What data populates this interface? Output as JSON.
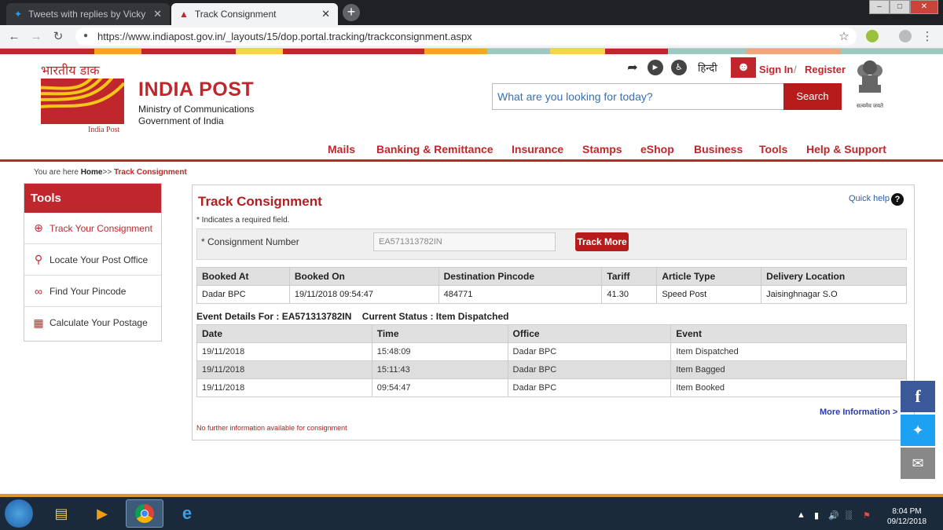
{
  "browser": {
    "tabs": [
      {
        "title": "Tweets with replies by Vicky Shri"
      },
      {
        "title": "Track Consignment"
      }
    ],
    "url": "https://www.indiapost.gov.in/_layouts/15/dop.portal.tracking/trackconsignment.aspx"
  },
  "header": {
    "logo_hindi": "भारतीय डाक",
    "logo_caption": "India Post",
    "brand": "INDIA POST",
    "ministry_line1": "Ministry of Communications",
    "ministry_line2": "Government of India",
    "hindi_link": "हिन्दी",
    "sign_in": "Sign In",
    "register": "Register",
    "search_placeholder": "What are you looking for today?",
    "search_button": "Search",
    "emblem_caption": "सत्यमेव जयते"
  },
  "nav": [
    "Mails",
    "Banking & Remittance",
    "Insurance",
    "Stamps",
    "eShop",
    "Business",
    "Tools",
    "Help & Support"
  ],
  "breadcrumb": {
    "prefix": "You are here",
    "home": "Home",
    "sep": ">>",
    "current": "Track Consignment"
  },
  "sidebar": {
    "title": "Tools",
    "items": [
      "Track Your Consignment",
      "Locate Your Post Office",
      "Find Your Pincode",
      "Calculate Your Postage"
    ]
  },
  "main": {
    "title": "Track Consignment",
    "required_note": "* Indicates a required field.",
    "quick_help": "Quick help",
    "consignment_label": "* Consignment Number",
    "consignment_value": "EA571313782IN",
    "track_more": "Track More",
    "booking_headers": [
      "Booked At",
      "Booked On",
      "Destination Pincode",
      "Tariff",
      "Article Type",
      "Delivery Location"
    ],
    "booking_row": [
      "Dadar BPC",
      "19/11/2018 09:54:47",
      "484771",
      "41.30",
      "Speed Post",
      "Jaisinghnagar S.O"
    ],
    "event_details_label": "Event Details For : EA571313782IN",
    "current_status_label": "Current Status : Item Dispatched",
    "event_headers": [
      "Date",
      "Time",
      "Office",
      "Event"
    ],
    "events": [
      [
        "19/11/2018",
        "15:48:09",
        "Dadar BPC",
        "Item Dispatched"
      ],
      [
        "19/11/2018",
        "15:11:43",
        "Dadar BPC",
        "Item Bagged"
      ],
      [
        "19/11/2018",
        "09:54:47",
        "Dadar BPC",
        "Item Booked"
      ]
    ],
    "more_info": "More Information >",
    "no_info": "No further information available for consignment"
  },
  "taskbar": {
    "time": "8:04 PM",
    "date": "09/12/2018"
  },
  "colors": {
    "brand_red": "#c0272d",
    "share_facebook": "#3b5998",
    "share_twitter": "#1da1f2",
    "share_mail": "#888888"
  }
}
